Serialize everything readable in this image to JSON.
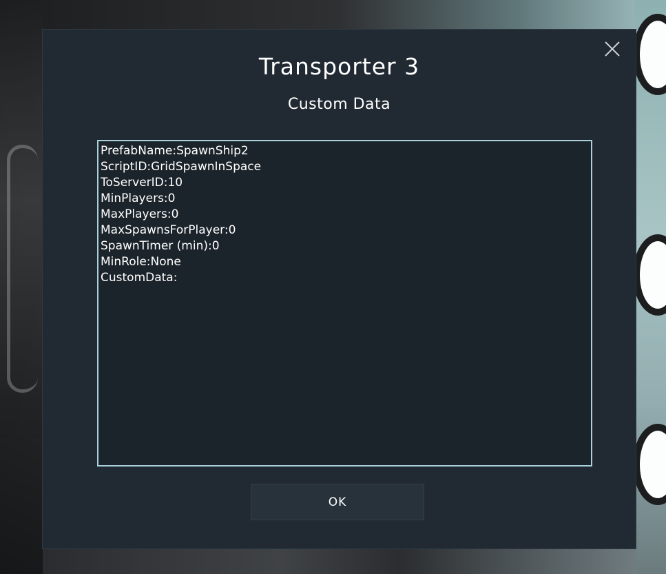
{
  "dialog": {
    "title": "Transporter 3",
    "subtitle": "Custom Data",
    "close_icon": "close-icon",
    "lines": [
      "PrefabName:SpawnShip2",
      "ScriptID:GridSpawnInSpace",
      "ToServerID:10",
      "MinPlayers:0",
      "MaxPlayers:0",
      "MaxSpawnsForPlayer:0",
      "SpawnTimer (min):0",
      "MinRole:None",
      "CustomData:"
    ],
    "ok_label": "OK"
  },
  "colors": {
    "dialog_bg": "#212a32",
    "textarea_border": "#a9d0dc",
    "text": "#ffffff",
    "button_bg": "#28323b"
  }
}
